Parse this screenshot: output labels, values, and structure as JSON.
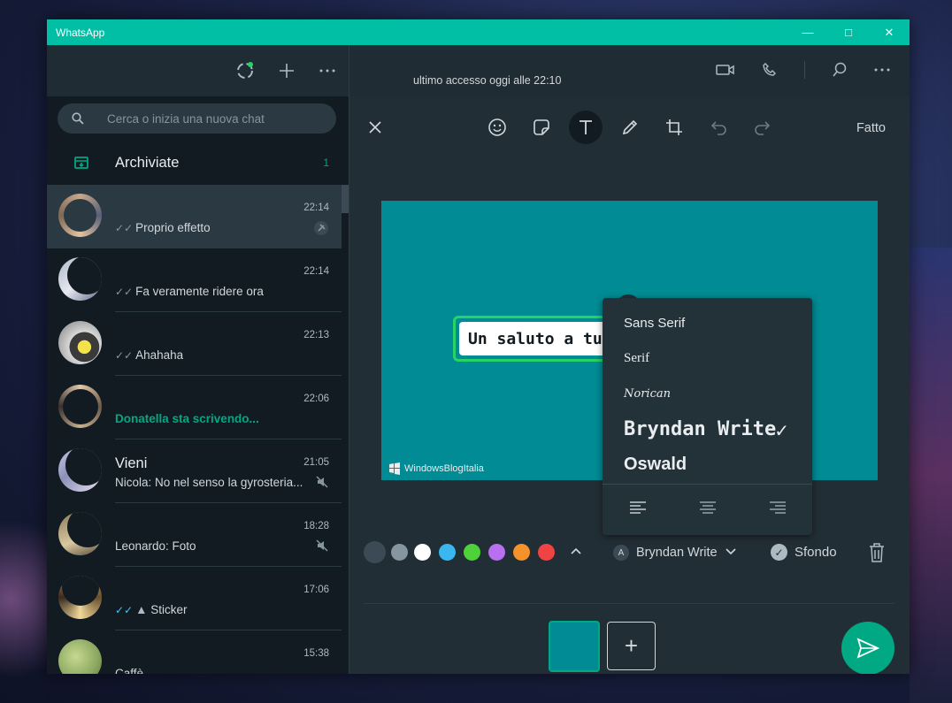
{
  "window": {
    "title": "WhatsApp"
  },
  "left": {
    "search_placeholder": "Cerca o inizia una nuova chat",
    "archived": {
      "label": "Archiviate",
      "count": "1"
    },
    "chats": [
      {
        "time": "22:14",
        "name": "",
        "preview": "Proprio effetto",
        "ticks": "read",
        "badge": "pin-icon",
        "active": true
      },
      {
        "time": "22:14",
        "name": "",
        "preview": "Fa veramente ridere ora",
        "ticks": "read"
      },
      {
        "time": "22:13",
        "name": "",
        "preview": "Ahahaha",
        "ticks": "read"
      },
      {
        "time": "22:06",
        "name": "",
        "preview": "Donatella sta scrivendo...",
        "typing": true
      },
      {
        "time": "21:05",
        "name": "Vieni",
        "preview": "Nicola: No nel senso la gyrosteria...",
        "badge": "muted-icon"
      },
      {
        "time": "18:28",
        "name": "",
        "preview": "Leonardo: Foto",
        "badge": "muted-icon",
        "photo": true
      },
      {
        "time": "17:06",
        "name": "",
        "preview": "Sticker",
        "ticks": "blue",
        "sticker": true
      },
      {
        "time": "15:38",
        "name": "",
        "preview": "Caffè"
      }
    ]
  },
  "right": {
    "last_seen": "ultimo accesso oggi alle 22:10",
    "done_label": "Fatto",
    "sticker_text": "Un saluto a tutti",
    "watermark": "WindowsBlogItalia",
    "font_menu": {
      "items": [
        "Sans Serif",
        "Serif",
        "Norican",
        "Bryndan Write",
        "Oswald"
      ],
      "selected": "Bryndan Write"
    },
    "selected_font": "Bryndan Write",
    "background_label": "Sfondo",
    "colors": [
      "#3b4a54",
      "#8696a0",
      "#ffffff",
      "#3bb7f0",
      "#4fd13a",
      "#b86ff0",
      "#f5922b",
      "#f04444"
    ],
    "colors_selected": 0
  }
}
